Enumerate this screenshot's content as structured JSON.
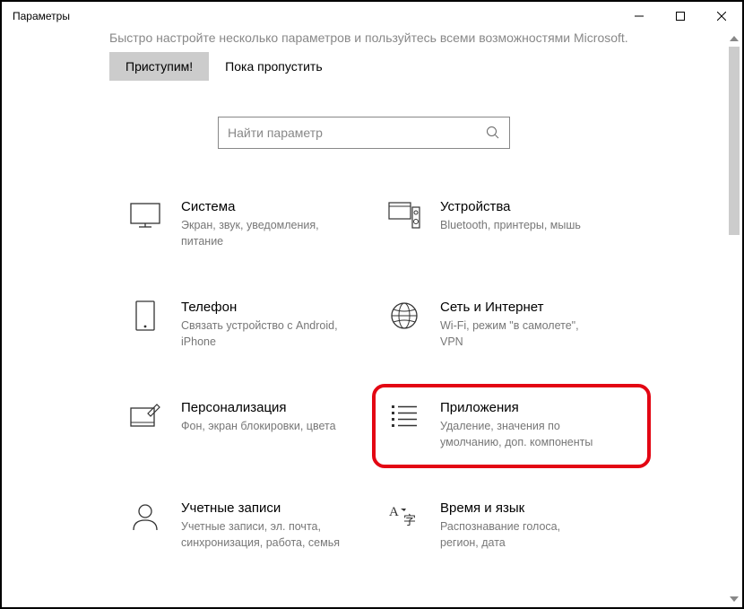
{
  "window": {
    "title": "Параметры"
  },
  "banner": {
    "truncated_text": "Быстро настройте несколько параметров и пользуйтесь всеми возможностями Microsoft.",
    "primary_btn": "Приступим!",
    "skip_btn": "Пока пропустить"
  },
  "search": {
    "placeholder": "Найти параметр"
  },
  "tiles": [
    {
      "title": "Система",
      "desc": "Экран, звук, уведомления, питание"
    },
    {
      "title": "Устройства",
      "desc": "Bluetooth, принтеры, мышь"
    },
    {
      "title": "Телефон",
      "desc": "Связать устройство с Android, iPhone"
    },
    {
      "title": "Сеть и Интернет",
      "desc": "Wi-Fi, режим \"в самолете\", VPN"
    },
    {
      "title": "Персонализация",
      "desc": "Фон, экран блокировки, цвета"
    },
    {
      "title": "Приложения",
      "desc": "Удаление, значения по умолчанию, доп. компоненты"
    },
    {
      "title": "Учетные записи",
      "desc": "Учетные записи, эл. почта, синхронизация, работа, семья"
    },
    {
      "title": "Время и язык",
      "desc": "Распознавание голоса, регион, дата"
    }
  ]
}
